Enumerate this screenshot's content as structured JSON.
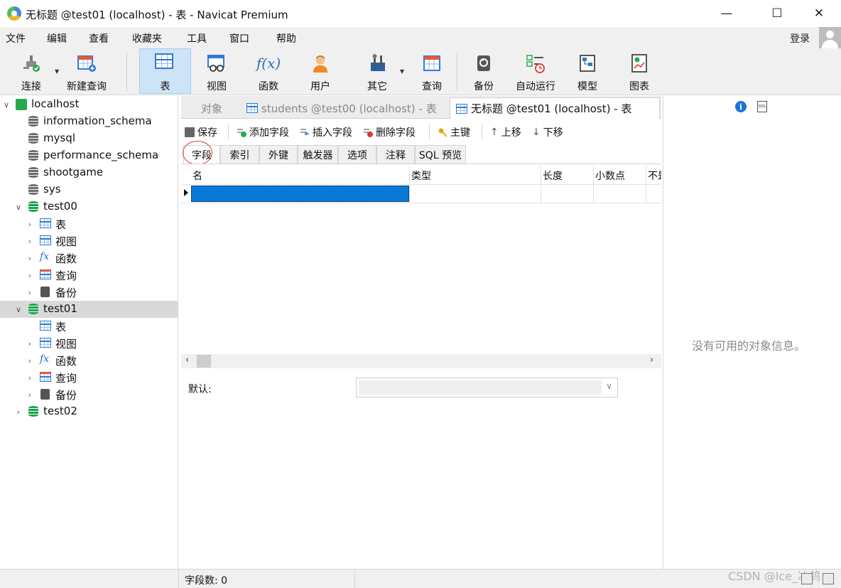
{
  "window": {
    "title": "无标题 @test01 (localhost) - 表 - Navicat Premium",
    "minimize": "—",
    "maximize": "☐",
    "close": "✕"
  },
  "menu": [
    "文件",
    "编辑",
    "查看",
    "收藏夹",
    "工具",
    "窗口",
    "帮助"
  ],
  "login": "登录",
  "toolbar": [
    {
      "label": "连接",
      "icon": "connection-plug-icon",
      "dropdown": true
    },
    {
      "label": "新建查询",
      "icon": "new-query-icon"
    },
    {
      "label": "表",
      "icon": "table-icon",
      "active": true
    },
    {
      "label": "视图",
      "icon": "view-icon"
    },
    {
      "label": "函数",
      "icon": "function-icon"
    },
    {
      "label": "用户",
      "icon": "user-icon"
    },
    {
      "label": "其它",
      "icon": "tools-icon",
      "dropdown": true
    },
    {
      "label": "查询",
      "icon": "query-icon"
    },
    {
      "label": "备份",
      "icon": "backup-icon"
    },
    {
      "label": "自动运行",
      "icon": "auto-run-icon"
    },
    {
      "label": "模型",
      "icon": "model-icon"
    },
    {
      "label": "图表",
      "icon": "chart-icon"
    }
  ],
  "tree": [
    {
      "label": "localhost",
      "level": 0,
      "expanded": true,
      "type": "connection"
    },
    {
      "label": "information_schema",
      "level": 1,
      "type": "db-grey"
    },
    {
      "label": "mysql",
      "level": 1,
      "type": "db-grey"
    },
    {
      "label": "performance_schema",
      "level": 1,
      "type": "db-grey"
    },
    {
      "label": "shootgame",
      "level": 1,
      "type": "db-grey"
    },
    {
      "label": "sys",
      "level": 1,
      "type": "db-grey"
    },
    {
      "label": "test00",
      "level": 1,
      "expanded": true,
      "type": "db-green"
    },
    {
      "label": "表",
      "level": 2,
      "type": "tables",
      "collapsed": true
    },
    {
      "label": "视图",
      "level": 2,
      "type": "views",
      "collapsed": true
    },
    {
      "label": "函数",
      "level": 2,
      "type": "functions",
      "collapsed": true
    },
    {
      "label": "查询",
      "level": 2,
      "type": "queries",
      "collapsed": true
    },
    {
      "label": "备份",
      "level": 2,
      "type": "backups",
      "collapsed": true
    },
    {
      "label": "test01",
      "level": 1,
      "expanded": true,
      "type": "db-green",
      "selected": true
    },
    {
      "label": "表",
      "level": 2,
      "type": "tables"
    },
    {
      "label": "视图",
      "level": 2,
      "type": "views",
      "collapsed": true
    },
    {
      "label": "函数",
      "level": 2,
      "type": "functions",
      "collapsed": true
    },
    {
      "label": "查询",
      "level": 2,
      "type": "queries",
      "collapsed": true
    },
    {
      "label": "备份",
      "level": 2,
      "type": "backups",
      "collapsed": true
    },
    {
      "label": "test02",
      "level": 1,
      "type": "db-green",
      "collapsed": true
    }
  ],
  "doc_tabs": [
    {
      "label": "对象",
      "active": false
    },
    {
      "label": "students @test00 (localhost) - 表",
      "active": false
    },
    {
      "label": "无标题 @test01 (localhost) - 表",
      "active": true
    }
  ],
  "editor_toolbar": {
    "save": "保存",
    "add_field": "添加字段",
    "insert_field": "插入字段",
    "delete_field": "删除字段",
    "primary_key": "主键",
    "move_up": "上移",
    "move_down": "下移"
  },
  "sub_tabs": [
    "字段",
    "索引",
    "外键",
    "触发器",
    "选项",
    "注释",
    "SQL 预览"
  ],
  "grid": {
    "columns": [
      "名",
      "类型",
      "长度",
      "小数点",
      "不是 null"
    ],
    "rows": [
      {
        "name": "",
        "type": "",
        "length": "",
        "decimals": ""
      }
    ]
  },
  "default_label": "默认:",
  "default_value": "",
  "info_panel": {
    "empty_text": "没有可用的对象信息。",
    "ddl_label": "DDL"
  },
  "status": {
    "field_count": "字段数: 0"
  },
  "watermark": "CSDN @Ice_冰鸽",
  "colors": {
    "selection": "#0a78d7",
    "active_tool": "#cde3f7",
    "db_green": "#19a34a",
    "circle_mark": "#d9392f"
  }
}
